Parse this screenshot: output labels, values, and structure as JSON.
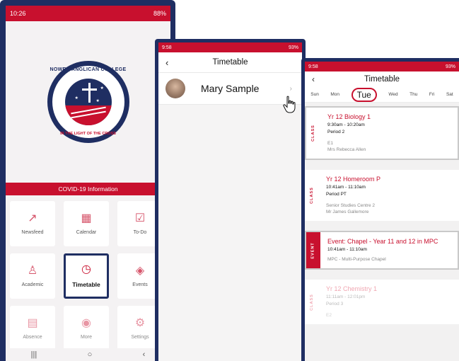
{
  "colors": {
    "brand_red": "#c8102e",
    "brand_navy": "#1f2e62"
  },
  "phone1": {
    "status": {
      "time": "10:26",
      "right": "88%"
    },
    "college": {
      "name_top": "NOWRA ANGLICAN COLLEGE",
      "motto": "IN THE LIGHT OF THE CROSS"
    },
    "covid_label": "COVID-19 Information",
    "tiles": [
      {
        "label": "Newsfeed",
        "icon": "trend-icon"
      },
      {
        "label": "Calendar",
        "icon": "calendar-icon"
      },
      {
        "label": "To-Do",
        "icon": "checklist-icon"
      },
      {
        "label": "Academic",
        "icon": "person-icon"
      },
      {
        "label": "Timetable",
        "icon": "clock-icon"
      },
      {
        "label": "Events",
        "icon": "ticket-icon"
      },
      {
        "label": "Absence",
        "icon": "document-icon"
      },
      {
        "label": "More",
        "icon": "more-icon"
      },
      {
        "label": "Settings",
        "icon": "gear-icon"
      }
    ]
  },
  "phone2": {
    "status": {
      "time": "9:58",
      "right": "93%"
    },
    "title": "Timetable",
    "student_name": "Mary Sample"
  },
  "phone3": {
    "status": {
      "time": "9:58",
      "right": "93%"
    },
    "title": "Timetable",
    "days": [
      "Sun",
      "Mon",
      "Tue",
      "Wed",
      "Thu",
      "Fri",
      "Sat"
    ],
    "entries": [
      {
        "tag": "CLASS",
        "name": "Yr 12 Biology 1",
        "time": "9:30am - 10:20am",
        "period": "Period 2",
        "room": "E1",
        "teacher": "Mrs Rebecca Allen"
      },
      {
        "tag": "CLASS",
        "name": "Yr 12 Homeroom P",
        "time": "10:41am - 11:10am",
        "period": "Period PT",
        "room": "Senior Studies Centre 2",
        "teacher": "Mr James Gallemore"
      },
      {
        "tag": "EVENT",
        "name": "Event: Chapel - Year 11 and 12 in MPC",
        "time": "10:41am - 11:10am",
        "room": "MPC - Multi-Purpose Chapel"
      },
      {
        "tag": "CLASS",
        "name": "Yr 12 Chemistry 1",
        "time": "11:11am - 12:01pm",
        "period": "Period 3",
        "room": "E2"
      }
    ]
  }
}
